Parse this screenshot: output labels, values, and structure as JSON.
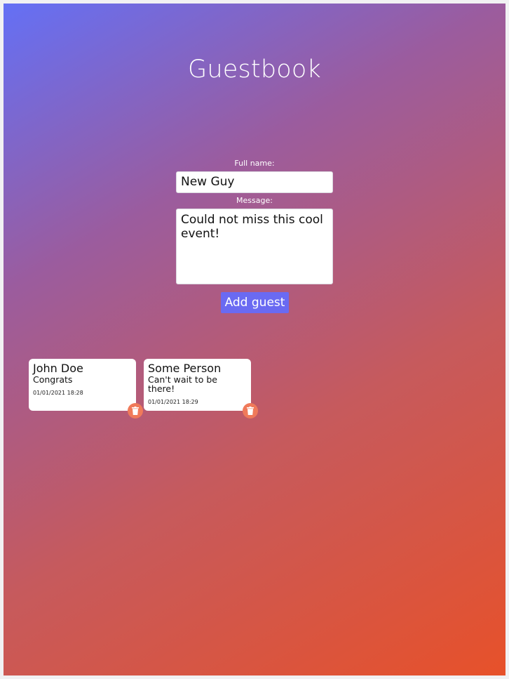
{
  "page": {
    "title": "Guestbook"
  },
  "form": {
    "name_label": "Full name:",
    "name_value": "New Guy",
    "message_label": "Message:",
    "message_value": "Could not miss this cool event!",
    "add_button_label": "Add guest"
  },
  "guests": [
    {
      "name": "John Doe",
      "message": "Congrats",
      "date": "01/01/2021 18:28"
    },
    {
      "name": "Some Person",
      "message": "Can't wait to be there!",
      "date": "01/01/2021 18:29"
    }
  ],
  "icons": {
    "delete": "trash-icon"
  },
  "colors": {
    "accent_button": "#6a6af2",
    "delete_button": "#f07a5a",
    "gradient_start": "#6470f5",
    "gradient_end": "#e7512a"
  }
}
